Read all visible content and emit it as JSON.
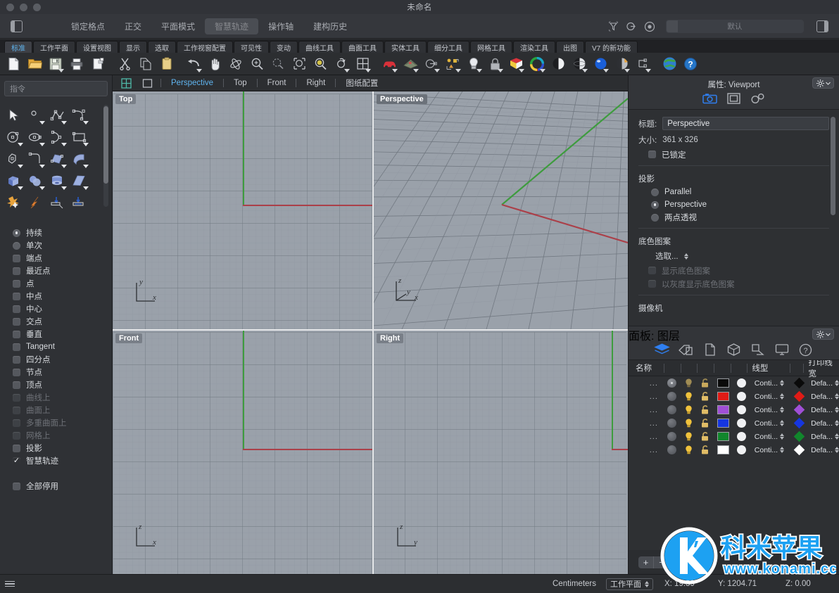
{
  "window": {
    "title": "未命名",
    "traffic_lights": [
      "close",
      "minimize",
      "zoom"
    ]
  },
  "options_bar": {
    "items": [
      {
        "label": "锁定格点",
        "active": false
      },
      {
        "label": "正交",
        "active": false
      },
      {
        "label": "平面模式",
        "active": false
      },
      {
        "label": "智慧轨迹",
        "active": true
      },
      {
        "label": "操作轴",
        "active": false
      },
      {
        "label": "建构历史",
        "active": false
      }
    ],
    "named_view_value": "默认",
    "icons": [
      "filter-icon",
      "layer-state-icon",
      "target-icon"
    ]
  },
  "toolbar_tabs": [
    {
      "label": "标准",
      "active": true
    },
    {
      "label": "工作平面",
      "active": false
    },
    {
      "label": "设置视图",
      "active": false
    },
    {
      "label": "显示",
      "active": false
    },
    {
      "label": "选取",
      "active": false
    },
    {
      "label": "工作视窗配置",
      "active": false
    },
    {
      "label": "可见性",
      "active": false
    },
    {
      "label": "变动",
      "active": false
    },
    {
      "label": "曲线工具",
      "active": false
    },
    {
      "label": "曲面工具",
      "active": false
    },
    {
      "label": "实体工具",
      "active": false
    },
    {
      "label": "细分工具",
      "active": false
    },
    {
      "label": "网格工具",
      "active": false
    },
    {
      "label": "渲染工具",
      "active": false
    },
    {
      "label": "出图",
      "active": false
    },
    {
      "label": "V7 的新功能",
      "active": false
    }
  ],
  "toolbar_icons": [
    "new-file-icon",
    "open-folder-icon",
    "save-icon",
    "print-icon",
    "copy-to-clipboard-icon",
    "cut-scissors-icon",
    "copy-icon",
    "paste-clipboard-icon",
    "undo-icon",
    "pan-hand-icon",
    "rotate-view-icon",
    "zoom-in-icon",
    "zoom-window-icon",
    "zoom-selected-icon",
    "zoom-extents-icon",
    "zoom-dynamic-icon",
    "four-view-icon",
    "render-car-icon",
    "mesh-render-icon",
    "dimension-icon",
    "layout-icon",
    "light-bulb-icon",
    "lock-icon",
    "surface-color-icon",
    "color-wheel-icon",
    "shaded-sphere-icon",
    "ghosted-sphere-icon",
    "rendered-sphere-icon",
    "material-cone-icon",
    "block-icon",
    "earth-globe-icon",
    "help-question-icon"
  ],
  "left_panel": {
    "command_placeholder": "指令",
    "snap_options": [
      {
        "label": "持续",
        "type": "radio",
        "checked": true,
        "disabled": false
      },
      {
        "label": "单次",
        "type": "radio",
        "checked": false,
        "disabled": false
      },
      {
        "label": "端点",
        "type": "checkbox",
        "checked": false,
        "disabled": false
      },
      {
        "label": "最近点",
        "type": "checkbox",
        "checked": false,
        "disabled": false
      },
      {
        "label": "点",
        "type": "checkbox",
        "checked": false,
        "disabled": false
      },
      {
        "label": "中点",
        "type": "checkbox",
        "checked": false,
        "disabled": false
      },
      {
        "label": "中心",
        "type": "checkbox",
        "checked": false,
        "disabled": false
      },
      {
        "label": "交点",
        "type": "checkbox",
        "checked": false,
        "disabled": false
      },
      {
        "label": "垂直",
        "type": "checkbox",
        "checked": false,
        "disabled": false
      },
      {
        "label": "Tangent",
        "type": "checkbox",
        "checked": false,
        "disabled": false
      },
      {
        "label": "四分点",
        "type": "checkbox",
        "checked": false,
        "disabled": false
      },
      {
        "label": "节点",
        "type": "checkbox",
        "checked": false,
        "disabled": false
      },
      {
        "label": "顶点",
        "type": "checkbox",
        "checked": false,
        "disabled": false
      },
      {
        "label": "曲线上",
        "type": "checkbox",
        "checked": false,
        "disabled": true
      },
      {
        "label": "曲面上",
        "type": "checkbox",
        "checked": false,
        "disabled": true
      },
      {
        "label": "多重曲面上",
        "type": "checkbox",
        "checked": false,
        "disabled": true
      },
      {
        "label": "网格上",
        "type": "checkbox",
        "checked": false,
        "disabled": true
      },
      {
        "label": "投影",
        "type": "checkbox",
        "checked": false,
        "disabled": false
      },
      {
        "label": "智慧轨迹",
        "type": "checkbox",
        "checked": true,
        "disabled": false
      }
    ],
    "disable_all": {
      "label": "全部停用",
      "type": "checkbox",
      "checked": false
    }
  },
  "viewport_header": {
    "icons": [
      "four-viewport-icon",
      "single-viewport-icon"
    ],
    "tabs": [
      {
        "label": "Perspective",
        "active": true
      },
      {
        "label": "Top",
        "active": false
      },
      {
        "label": "Front",
        "active": false
      },
      {
        "label": "Right",
        "active": false
      },
      {
        "label": "图纸配置",
        "active": false
      }
    ]
  },
  "viewports": [
    {
      "name": "Top",
      "axes": [
        "y",
        "x"
      ],
      "active": false
    },
    {
      "name": "Perspective",
      "axes": [
        "z",
        "y",
        "x"
      ],
      "active": true
    },
    {
      "name": "Front",
      "axes": [
        "z",
        "x"
      ],
      "active": false
    },
    {
      "name": "Right",
      "axes": [
        "z",
        "y"
      ],
      "active": false
    }
  ],
  "properties_panel": {
    "title": "属性: Viewport",
    "gear_label": "gear-icon",
    "tab_icons": [
      "camera-icon",
      "viewport-frame-icon",
      "link-icon"
    ],
    "title_label": "标题:",
    "title_value": "Perspective",
    "size_label": "大小:",
    "size_value": "361 x 326",
    "locked_label": "已锁定",
    "locked_checked": false,
    "projection_heading": "投影",
    "projection_options": [
      {
        "label": "Parallel",
        "checked": false
      },
      {
        "label": "Perspective",
        "checked": true
      },
      {
        "label": "两点透视",
        "checked": false
      }
    ],
    "wallpaper_heading": "底色图案",
    "wallpaper_select": "选取...",
    "wallpaper_checks": [
      {
        "label": "显示底色图案",
        "checked": false,
        "disabled": true
      },
      {
        "label": "以灰度显示底色图案",
        "checked": false,
        "disabled": true
      }
    ],
    "camera_heading": "摄像机"
  },
  "layer_panel": {
    "title": "面板: 图层",
    "tab_icons": [
      "layers-icon",
      "materials-icon",
      "notes-icon",
      "blocks-icon",
      "named-cplanes-icon",
      "display-icon",
      "help-icon"
    ],
    "columns": [
      "名称",
      "线型",
      "打印线宽"
    ],
    "rows": [
      {
        "name": "...",
        "on": true,
        "color": "#0a0a0a",
        "linetype": "Conti...",
        "printcolor": "#0a0a0a",
        "printwidth": "Defa..."
      },
      {
        "name": "...",
        "on": false,
        "color": "#e01b16",
        "linetype": "Conti...",
        "printcolor": "#e01b16",
        "printwidth": "Defa..."
      },
      {
        "name": "...",
        "on": false,
        "color": "#a04fd6",
        "linetype": "Conti...",
        "printcolor": "#a04fd6",
        "printwidth": "Defa..."
      },
      {
        "name": "...",
        "on": false,
        "color": "#1636e0",
        "linetype": "Conti...",
        "printcolor": "#1636e0",
        "printwidth": "Defa..."
      },
      {
        "name": "...",
        "on": false,
        "color": "#11862c",
        "linetype": "Conti...",
        "printcolor": "#11862c",
        "printwidth": "Defa..."
      },
      {
        "name": "...",
        "on": false,
        "color": "#ffffff",
        "linetype": "Conti...",
        "printcolor": "#ffffff",
        "printwidth": "Defa..."
      }
    ],
    "add_label": "+",
    "remove_label": "−"
  },
  "status_bar": {
    "units": "Centimeters",
    "cplane_label": "工作平面",
    "x": "X: 19.39",
    "y": "Y: 1204.71",
    "z": "Z: 0.00"
  },
  "watermark": {
    "brand": "科米苹果",
    "url": "www.konami.cc",
    "letter": "K",
    "color": "#1da1f2"
  }
}
